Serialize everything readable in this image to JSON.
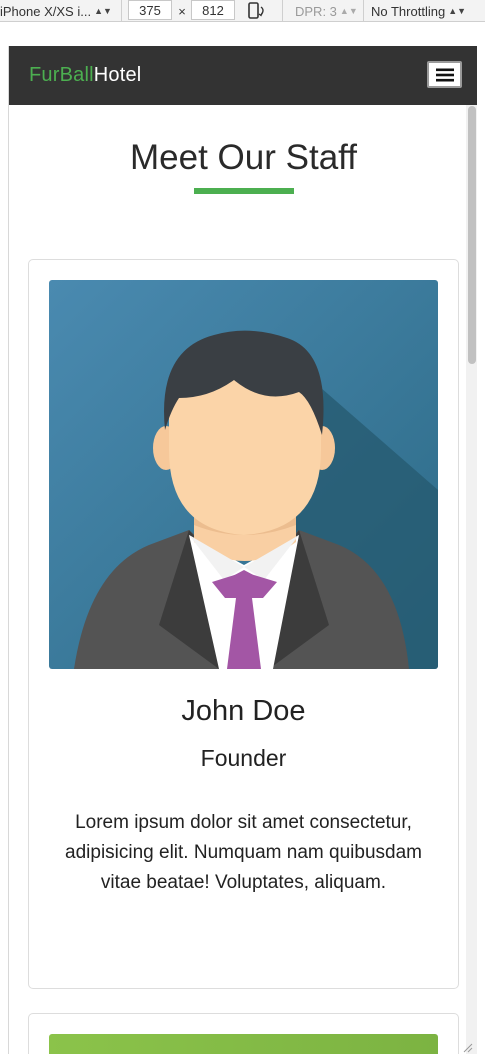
{
  "devtools": {
    "device": "iPhone X/XS i...",
    "width": "375",
    "times": "×",
    "height": "812",
    "dpr": "DPR: 3",
    "throttling": "No Throttling"
  },
  "navbar": {
    "brand_part1": "FurBall",
    "brand_part2": "Hotel",
    "menu_icon": "hamburger-icon"
  },
  "section": {
    "title": "Meet Our Staff",
    "accent_color": "#4caf50"
  },
  "staff": [
    {
      "name": "John Doe",
      "role": "Founder",
      "bio": "Lorem ipsum dolor sit amet consectetur, adipisicing elit. Numquam nam quibusdam vitae beatae! Voluptates, aliquam.",
      "image_icon": "businessman-avatar-icon"
    }
  ],
  "colors": {
    "navbar_bg": "#333333",
    "brand_green": "#4caf50",
    "avatar_bg": "#3f7f9c",
    "tie": "#a356a5"
  }
}
